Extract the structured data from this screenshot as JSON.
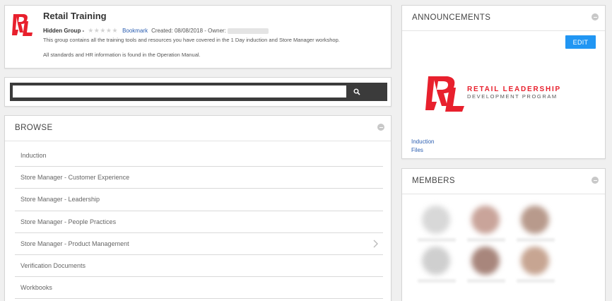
{
  "group": {
    "title": "Retail Training",
    "visibility": "Hidden Group -",
    "stars": "★★★★★",
    "bookmark_label": "Bookmark",
    "created_text": "Created: 08/08/2018 - Owner:",
    "description_line1": "This group contains all the training tools and resources you have covered in the 1 Day induction and Store Manager workshop.",
    "description_line2": "All standards and HR information is found in the Operation Manual."
  },
  "search": {
    "placeholder": "",
    "button_icon": "search-icon"
  },
  "browse": {
    "title": "BROWSE",
    "items": [
      {
        "label": "Induction"
      },
      {
        "label": "Store Manager - Customer Experience"
      },
      {
        "label": "Store Manager - Leadership"
      },
      {
        "label": "Store Manager - People Practices"
      },
      {
        "label": "Store Manager - Product Management",
        "has_chevron": true
      },
      {
        "label": "Verification Documents"
      },
      {
        "label": "Workbooks"
      }
    ]
  },
  "announcements": {
    "title": "ANNOUNCEMENTS",
    "edit_label": "EDIT",
    "brand_line1": "RETAIL LEADERSHIP",
    "brand_line2": "DEVELOPMENT PROGRAM",
    "links": [
      "Induction",
      "Files"
    ]
  },
  "members": {
    "title": "MEMBERS"
  },
  "colors": {
    "accent": "#2196f3",
    "brand_red": "#e8202d",
    "link": "#2a5db0",
    "search_bar": "#3b3b3b"
  }
}
